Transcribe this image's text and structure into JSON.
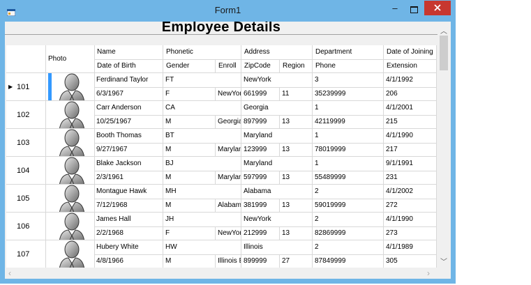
{
  "window": {
    "title": "Form1"
  },
  "heading": "Employee Details",
  "grid": {
    "header_top": [
      "Name",
      "Phonetic",
      "Address",
      "Department",
      "Date of Joining"
    ],
    "header_bottom": [
      "Date of Birth",
      "Gender",
      "Enroll",
      "ZipCode",
      "Region",
      "Phone",
      "Extension"
    ],
    "photo_header": "Photo",
    "current_row_marker": "▶",
    "rows": [
      {
        "id": "101",
        "name": "Ferdinand Taylor",
        "phonetic": "FT",
        "address": "NewYork",
        "department": "3",
        "joining": "4/1/1992",
        "dob": "6/3/1967",
        "gender": "F",
        "enroll": "NewYork",
        "zip": "661999",
        "region": "11",
        "phone": "35239999",
        "ext": "206"
      },
      {
        "id": "102",
        "name": "Carr Anderson",
        "phonetic": "CA",
        "address": "Georgia",
        "department": "1",
        "joining": "4/1/2001",
        "dob": "10/25/1967",
        "gender": "M",
        "enroll": "Georgia",
        "zip": "897999",
        "region": "13",
        "phone": "42119999",
        "ext": "215"
      },
      {
        "id": "103",
        "name": "Booth Thomas",
        "phonetic": "BT",
        "address": "Maryland",
        "department": "1",
        "joining": "4/1/1990",
        "dob": "9/27/1967",
        "gender": "M",
        "enroll": "Maryland",
        "zip": "123999",
        "region": "13",
        "phone": "78019999",
        "ext": "217"
      },
      {
        "id": "104",
        "name": "Blake Jackson",
        "phonetic": "BJ",
        "address": "Maryland",
        "department": "1",
        "joining": "9/1/1991",
        "dob": "2/3/1961",
        "gender": "M",
        "enroll": "Maryland",
        "zip": "597999",
        "region": "13",
        "phone": "55489999",
        "ext": "231"
      },
      {
        "id": "105",
        "name": "Montague Hawk",
        "phonetic": "MH",
        "address": "Alabama",
        "department": "2",
        "joining": "4/1/2002",
        "dob": "7/12/1968",
        "gender": "M",
        "enroll": "Alabama",
        "zip": "381999",
        "region": "13",
        "phone": "59019999",
        "ext": "272"
      },
      {
        "id": "106",
        "name": "James Hall",
        "phonetic": "JH",
        "address": "NewYork",
        "department": "2",
        "joining": "4/1/1990",
        "dob": "2/2/1968",
        "gender": "F",
        "enroll": "NewYork",
        "zip": "212999",
        "region": "13",
        "phone": "82869999",
        "ext": "273"
      },
      {
        "id": "107",
        "name": "Hubery White",
        "phonetic": "HW",
        "address": "Illinois",
        "department": "2",
        "joining": "4/1/1989",
        "dob": "4/8/1966",
        "gender": "M",
        "enroll": "Illinois E",
        "zip": "899999",
        "region": "27",
        "phone": "87849999",
        "ext": "305"
      }
    ]
  },
  "colors": {
    "accent_selection": "#3399ff",
    "close_button": "#c7372f",
    "window_border": "#6fb5e6"
  },
  "icons": {
    "app": "form-app-icon",
    "minimize": "minimize-icon",
    "maximize": "maximize-icon",
    "close": "close-icon",
    "photo": "person-silhouette-icon"
  }
}
